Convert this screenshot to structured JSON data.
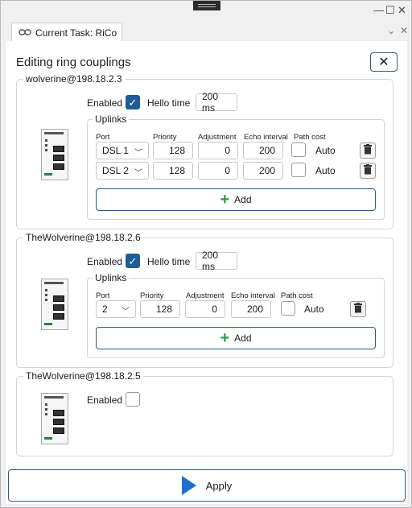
{
  "window_controls": {
    "minimize": "—",
    "maximize": "☐",
    "close": "✕"
  },
  "tab": {
    "label": "Current Task: RiCo",
    "chevron": "⌄",
    "close": "✕"
  },
  "title": "Editing ring couplings",
  "close_button": "✕",
  "columns": {
    "port": "Port",
    "priority": "Priority",
    "adjustment": "Adjustment",
    "echo_interval": "Echo interval",
    "path_cost": "Path cost"
  },
  "groups": [
    {
      "name": "wolverine@198.18.2.3",
      "enabled_label": "Enabled",
      "enabled": true,
      "hello_label": "Hello time",
      "hello_value": "200 ms",
      "uplinks_label": "Uplinks",
      "uplinks": [
        {
          "port": "DSL 1",
          "priority": "128",
          "adjustment": "0",
          "echo": "200",
          "path_cost_label": "Auto"
        },
        {
          "port": "DSL 2",
          "priority": "128",
          "adjustment": "0",
          "echo": "200",
          "path_cost_label": "Auto"
        }
      ],
      "add_label": "Add"
    },
    {
      "name": "TheWolverine@198.18.2.6",
      "enabled_label": "Enabled",
      "enabled": true,
      "hello_label": "Hello time",
      "hello_value": "200 ms",
      "uplinks_label": "Uplinks",
      "uplinks": [
        {
          "port": "2",
          "priority": "128",
          "adjustment": "0",
          "echo": "200",
          "path_cost_label": "Auto"
        }
      ],
      "add_label": "Add"
    },
    {
      "name": "TheWolverine@198.18.2.5",
      "enabled_label": "Enabled",
      "enabled": false
    }
  ],
  "apply_label": "Apply",
  "colors": {
    "accent": "#1f5c99",
    "add_plus": "#2e9b3e",
    "apply_play": "#1f6fd1"
  }
}
